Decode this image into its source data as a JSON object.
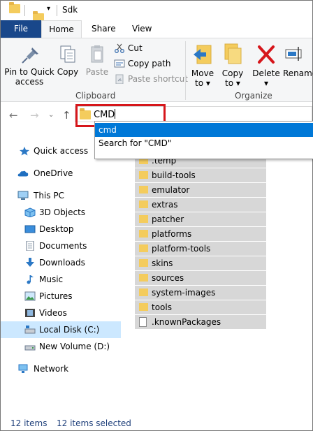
{
  "window": {
    "title": "Sdk"
  },
  "ribbon_tabs": [
    "File",
    "Home",
    "Share",
    "View"
  ],
  "clipboard": {
    "pin_label_1": "Pin to Quick",
    "pin_label_2": "access",
    "copy_label": "Copy",
    "paste_label": "Paste",
    "cut_label": "Cut",
    "copy_path_label": "Copy path",
    "paste_shortcut_label": "Paste shortcut",
    "group_label": "Clipboard"
  },
  "organize": {
    "move_to_label": "Move",
    "move_to_sub": "to",
    "copy_to_label": "Copy",
    "copy_to_sub": "to",
    "delete_label": "Delete",
    "rename_label": "Rename",
    "group_label": "Organize"
  },
  "address_bar": {
    "value": "CMD"
  },
  "suggestions": [
    {
      "label": "cmd"
    },
    {
      "label": "Search for \"CMD\""
    }
  ],
  "nav_pane": {
    "quick_access": "Quick access",
    "onedrive": "OneDrive",
    "this_pc": "This PC",
    "items": [
      "3D Objects",
      "Desktop",
      "Documents",
      "Downloads",
      "Music",
      "Pictures",
      "Videos",
      "Local Disk (C:)",
      "New Volume (D:)"
    ],
    "network": "Network"
  },
  "files": [
    ".temp",
    "build-tools",
    "emulator",
    "extras",
    "patcher",
    "platforms",
    "platform-tools",
    "skins",
    "sources",
    "system-images",
    "tools",
    ".knownPackages"
  ],
  "status": {
    "item_count": "12 items",
    "selected_count": "12 items selected"
  },
  "colors": {
    "file_tab": "#19478a",
    "selection": "#0078d7",
    "highlight_box": "#d6161b",
    "row_selected": "#d7d7d7"
  }
}
